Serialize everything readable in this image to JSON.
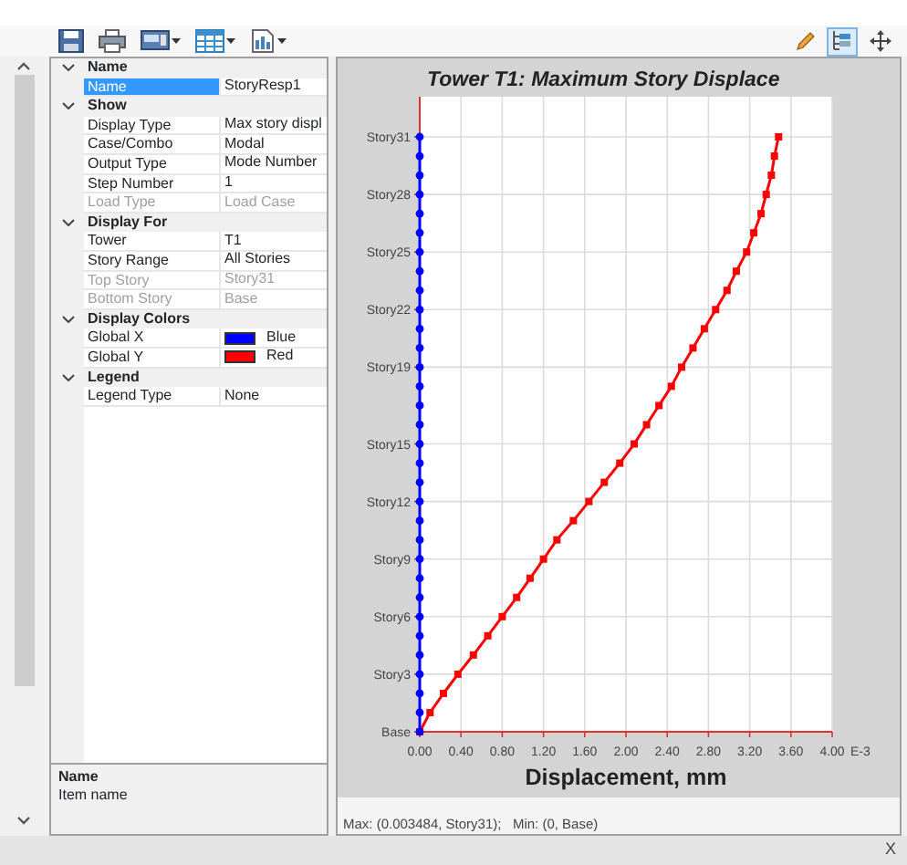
{
  "toolbar": [
    {
      "kind": "save",
      "dropdown": false
    },
    {
      "kind": "print",
      "dropdown": false
    },
    {
      "kind": "display",
      "dropdown": true
    },
    {
      "kind": "table",
      "dropdown": true
    },
    {
      "kind": "report",
      "dropdown": true
    }
  ],
  "tools": [
    {
      "kind": "pencil",
      "selected": false
    },
    {
      "kind": "tree",
      "selected": true
    },
    {
      "kind": "move",
      "selected": false
    }
  ],
  "property_grid": {
    "categories": [
      {
        "title": "Name",
        "expanded": true,
        "rows": [
          {
            "label": "Name",
            "value": "StoryResp1",
            "selected": true,
            "disabled": false
          }
        ]
      },
      {
        "title": "Show",
        "expanded": true,
        "rows": [
          {
            "label": "Display Type",
            "value": "Max story displ",
            "selected": false,
            "disabled": false
          },
          {
            "label": "Case/Combo",
            "value": "Modal",
            "selected": false,
            "disabled": false
          },
          {
            "label": "Output Type",
            "value": "Mode Number",
            "selected": false,
            "disabled": false
          },
          {
            "label": "Step Number",
            "value": "1",
            "selected": false,
            "disabled": false
          },
          {
            "label": "Load Type",
            "value": "Load Case",
            "selected": false,
            "disabled": true
          }
        ]
      },
      {
        "title": "Display For",
        "expanded": true,
        "rows": [
          {
            "label": "Tower",
            "value": "T1",
            "selected": false,
            "disabled": false
          },
          {
            "label": "Story Range",
            "value": "All Stories",
            "selected": false,
            "disabled": false
          },
          {
            "label": "Top Story",
            "value": "Story31",
            "selected": false,
            "disabled": true
          },
          {
            "label": "Bottom Story",
            "value": "Base",
            "selected": false,
            "disabled": true
          }
        ]
      },
      {
        "title": "Display Colors",
        "expanded": true,
        "rows": [
          {
            "label": "Global X",
            "value": "Blue",
            "color": "#0000ff",
            "selected": false,
            "disabled": false
          },
          {
            "label": "Global Y",
            "value": "Red",
            "color": "#ff0000",
            "selected": false,
            "disabled": false
          }
        ]
      },
      {
        "title": "Legend",
        "expanded": true,
        "rows": [
          {
            "label": "Legend Type",
            "value": "None",
            "selected": false,
            "disabled": false
          }
        ]
      }
    ]
  },
  "description": {
    "title": "Name",
    "text": "Item name"
  },
  "chart": {
    "chart_data": {
      "type": "line",
      "orientation": "horizontal",
      "grid": true,
      "title": "Tower T1:  Maximum Story Displace",
      "xlabel": "Displacement, mm",
      "xlim": [
        0,
        4
      ],
      "categories": [
        "Story31",
        null,
        null,
        "Story28",
        null,
        null,
        "Story25",
        null,
        null,
        "Story22",
        null,
        null,
        "Story19",
        null,
        null,
        null,
        "Story15",
        null,
        null,
        "Story12",
        null,
        null,
        "Story9",
        null,
        null,
        "Story6",
        null,
        null,
        "Story3",
        null,
        null,
        "Base"
      ],
      "xticks": [
        {
          "value": 0,
          "label": "0.00"
        },
        {
          "value": 0.4,
          "label": "0.40"
        },
        {
          "value": 0.8,
          "label": "0.80"
        },
        {
          "value": 1.2,
          "label": "1.20"
        },
        {
          "value": 1.6,
          "label": "1.60"
        },
        {
          "value": 2,
          "label": "2.00"
        },
        {
          "value": 2.4,
          "label": "2.40"
        },
        {
          "value": 2.8,
          "label": "2.80"
        },
        {
          "value": 3.2,
          "label": "3.20"
        },
        {
          "value": 3.6,
          "label": "3.60"
        },
        {
          "value": 4,
          "label": "4.00"
        }
      ],
      "series": [
        {
          "color": "#0000ff",
          "marker": "circle",
          "values": [
            0,
            0,
            0,
            0,
            0,
            0,
            0,
            0,
            0,
            0,
            0,
            0,
            0,
            0,
            0,
            0,
            0,
            0,
            0,
            0,
            0,
            0,
            0,
            0,
            0,
            0,
            0,
            0,
            0,
            0,
            0,
            0
          ]
        },
        {
          "color": "#ff0000",
          "marker": "square",
          "values": [
            3.48,
            3.44,
            3.41,
            3.36,
            3.31,
            3.24,
            3.17,
            3.07,
            2.98,
            2.87,
            2.76,
            2.65,
            2.54,
            2.44,
            2.32,
            2.2,
            2.08,
            1.94,
            1.79,
            1.64,
            1.49,
            1.33,
            1.2,
            1.07,
            0.94,
            0.8,
            0.66,
            0.52,
            0.37,
            0.23,
            0.1,
            0
          ]
        }
      ]
    },
    "exponent": "E-3",
    "footer": "Max: (0.003484, Story31);   Min: (0, Base)"
  },
  "close_label": "X"
}
